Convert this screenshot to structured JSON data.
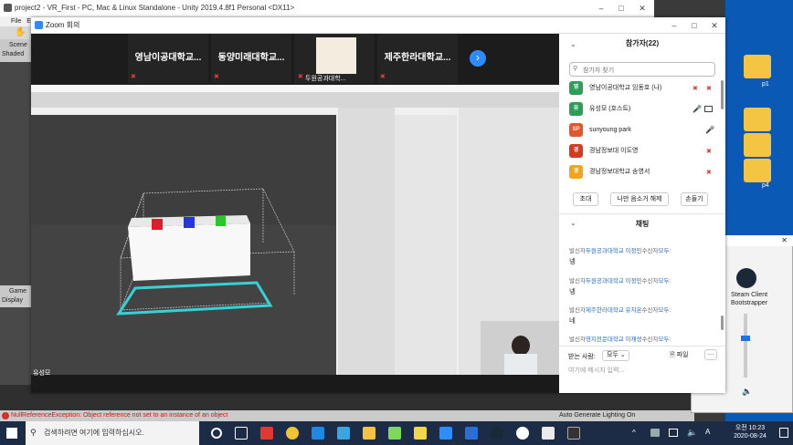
{
  "unity": {
    "title": "project2 - VR_First - PC, Mac & Linux Standalone - Unity 2019.4.8f1 Personal <DX11>",
    "menu": "File  Edit",
    "scene_tab": "Scene",
    "scene_shaded": "Shaded",
    "game_tab": "Game",
    "game_display": "Display",
    "status_error": "NullReferenceException: Object reference not set to an instance of an object",
    "autogen": "Auto Generate Lighting On"
  },
  "desktop": {
    "icons": [
      {
        "label": "p1"
      },
      {
        "label": "p2"
      },
      {
        "label": "p3"
      },
      {
        "label": "p4"
      }
    ],
    "steam_label": "Steam Client Bootstrapper"
  },
  "zoom": {
    "title": "Zoom 회의",
    "thumbs": [
      {
        "name": "영남이공대학교..."
      },
      {
        "name": "동양미래대학교..."
      },
      {
        "name": "두원공과대학..."
      },
      {
        "name": "제주한라대학교..."
      }
    ],
    "share_name": "유성모",
    "next_icon": "chevron-right-icon",
    "participants": {
      "header": "참가자(22)",
      "search_placeholder": "참가자 찾기",
      "list": [
        {
          "initial": "영",
          "name": "영남이공대학교 임동호 (나)",
          "color": "#2e9e5b"
        },
        {
          "initial": "유",
          "name": "유성모 (호스트)",
          "color": "#2e9e5b"
        },
        {
          "initial": "SP",
          "name": "sunyoung park",
          "color": "#e4572e"
        },
        {
          "initial": "경",
          "name": "경남정보대 이도영",
          "color": "#e4572e"
        },
        {
          "initial": "경",
          "name": "경남정보대학교 송영서",
          "color": "#f2a51a"
        }
      ],
      "invite_label": "초대",
      "unmute_label": "나만 음소거 해제",
      "raise_label": "손들기"
    },
    "chat": {
      "header": "채팅",
      "messages": [
        {
          "prefix": "발신자",
          "sender": "두원공과대학교 이정민",
          "mid": "수신자",
          "to": "모두",
          "text": "넹"
        },
        {
          "prefix": "발신자",
          "sender": "두원공과대학교 이정민",
          "mid": "수신자",
          "to": "모두",
          "text": "넹"
        },
        {
          "prefix": "발신자",
          "sender": "제주한라대학교 유치온",
          "mid": "수신자",
          "to": "모두",
          "text": "네"
        },
        {
          "prefix": "발신자",
          "sender": "영지전문대학교 이재성",
          "mid": "수신자",
          "to": "모두",
          "text": ""
        }
      ],
      "to_label": "받는 사람:",
      "to_value": "모두",
      "file_label": "파일",
      "input_placeholder": "여기에 메시지 입력..."
    }
  },
  "taskbar": {
    "search_placeholder": "검색하려면 여기에 입력하십시오.",
    "time": "오전 10:23",
    "date": "2020-08-24"
  }
}
